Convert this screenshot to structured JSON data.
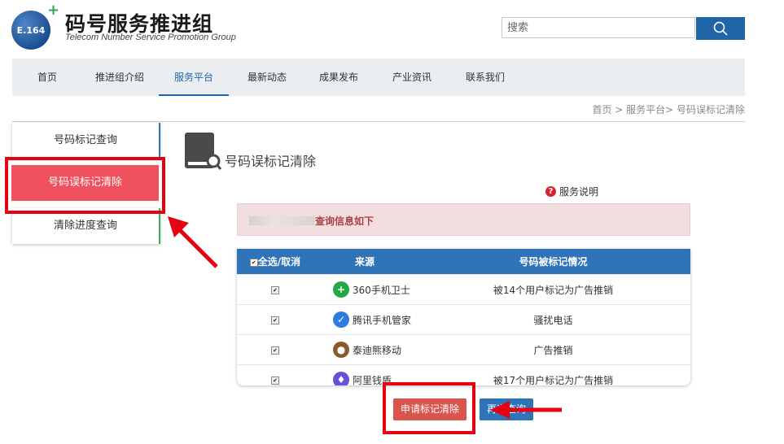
{
  "header": {
    "logo_text": "E.164",
    "title": "码号服务推进组",
    "subtitle": "Telecom Number Service  Promotion Group",
    "search_placeholder": "搜索"
  },
  "nav": {
    "items": [
      "首页",
      "推进组介绍",
      "服务平台",
      "最新动态",
      "成果发布",
      "产业资讯",
      "联系我们"
    ],
    "active": "服务平台"
  },
  "breadcrumb": "首页 > 服务平台> 号码误标记清除",
  "sidebar": {
    "items": [
      "号码标记查询",
      "号码误标记清除",
      "清除进度查询"
    ],
    "active": "号码误标记清除"
  },
  "main": {
    "section_title": "号码误标记清除",
    "help_label": "服务说明",
    "info_text": "查询信息如下",
    "table": {
      "headers": [
        "全选/取消",
        "来源",
        "号码被标记情况"
      ],
      "rows": [
        {
          "checked": true,
          "source": "360手机卫士",
          "status": "被14个用户标记为广告推销",
          "icon": "360-guard-icon",
          "color": "#23a843"
        },
        {
          "checked": true,
          "source": "腾讯手机管家",
          "status": "骚扰电话",
          "icon": "tencent-manager-icon",
          "color": "#2d7de0"
        },
        {
          "checked": true,
          "source": "泰迪熊移动",
          "status": "广告推销",
          "icon": "teddy-bear-icon",
          "color": "#8a5a2e"
        },
        {
          "checked": true,
          "source": "阿里钱盾",
          "status": "被17个用户标记为广告推销",
          "icon": "ali-shield-icon",
          "color": "#6a4fd8"
        }
      ]
    },
    "buttons": {
      "apply": "申请标记清除",
      "requery": "再次查询"
    }
  },
  "colors": {
    "brand_blue": "#1f65a8",
    "active_red": "#f0515e",
    "annotation_red": "#e60012"
  }
}
